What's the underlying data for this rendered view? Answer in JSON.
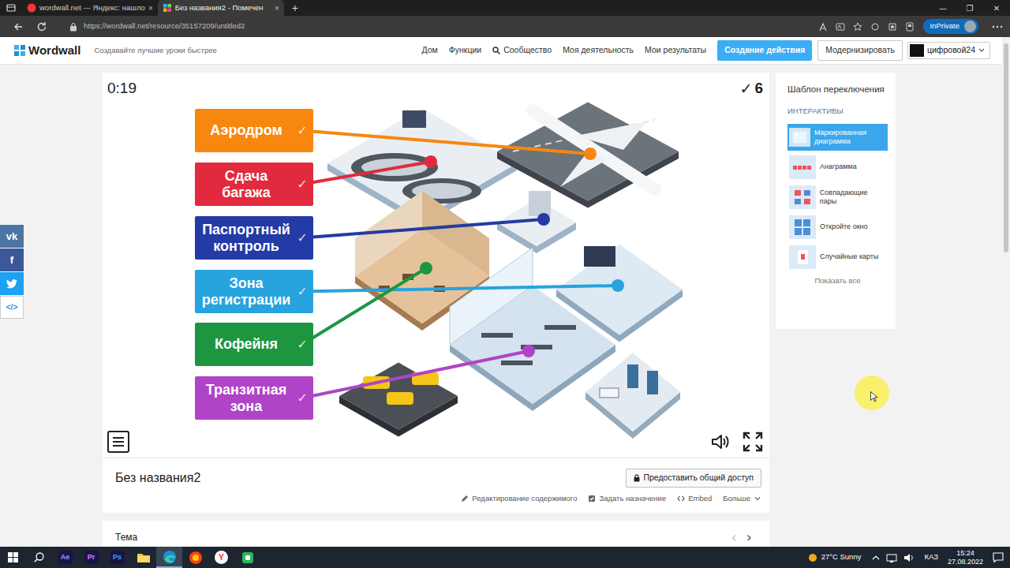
{
  "browser": {
    "tabs": [
      {
        "label": "wordwall.net — Яндекс: нашло",
        "selected": false
      },
      {
        "label": "Без названия2 - Помечен",
        "selected": true
      }
    ],
    "close": "×",
    "new_tab": "+",
    "controls": [
      "—",
      "❐",
      "✕"
    ],
    "url": "https://wordwall.net/resource/35157209/untitled2",
    "inprivate": "InPrivate"
  },
  "site": {
    "logo": "Wordwall",
    "tagline": "Создавайте лучшие уроки быстрее",
    "nav": [
      "Дом",
      "Функции",
      "Сообщество",
      "Моя деятельность",
      "Мои результаты"
    ],
    "create": "Создание действия",
    "upgrade": "Модернизировать",
    "user": "цифровой24"
  },
  "social": [
    {
      "kind": "vk",
      "label": "vk",
      "color": "#4c75a3"
    },
    {
      "kind": "facebook",
      "label": "f",
      "color": "#3b5998"
    },
    {
      "kind": "twitter",
      "color": "#1da1f2"
    },
    {
      "kind": "embed",
      "label": "</>",
      "color": "#ffffff"
    }
  ],
  "game": {
    "timer": "0:19",
    "score_icon": "✓",
    "score": "6",
    "labels": [
      {
        "text": "Аэродром",
        "color": "#f7870f",
        "correct": true,
        "check": "✓"
      },
      {
        "text": "Сдача багажа",
        "color": "#e22a3e",
        "correct": true,
        "check": "✓"
      },
      {
        "text": "Паспортный контроль",
        "color": "#243aa6",
        "correct": true,
        "check": "✓"
      },
      {
        "text": "Зона регистрации",
        "color": "#27a3dd",
        "correct": true,
        "check": "✓"
      },
      {
        "text": "Кофейня",
        "color": "#1e9641",
        "correct": true,
        "check": "✓"
      },
      {
        "text": "Транзитная зона",
        "color": "#b044c6",
        "correct": true,
        "check": "✓"
      }
    ]
  },
  "activity": {
    "title": "Без названия2",
    "share": "Предоставить общий доступ",
    "actions": [
      {
        "kind": "edit",
        "label": "Редактирование содержимого"
      },
      {
        "kind": "assign",
        "label": "Задать назначение"
      },
      {
        "kind": "embed",
        "label": "Embed"
      },
      {
        "kind": "more",
        "label": "Больше"
      }
    ]
  },
  "theme": {
    "title": "Тема",
    "arrows": [
      {
        "label": "‹",
        "disabled": true
      },
      {
        "label": "›",
        "disabled": false
      }
    ]
  },
  "templates": {
    "title": "Шаблон переключения",
    "section": "ИНТЕРАКТИВЫ",
    "items": [
      {
        "label": "Маркированная диаграмма",
        "selected": true
      },
      {
        "label": "Анаграмма",
        "selected": false
      },
      {
        "label": "Совпадающие пары",
        "selected": false
      },
      {
        "label": "Откройте окно",
        "selected": false
      },
      {
        "label": "Случайные карты",
        "selected": false
      }
    ],
    "show_all": "Показать все"
  },
  "taskbar": {
    "apps": [
      {
        "kind": "adobe",
        "label": "Ae",
        "color": "#9999ff",
        "selected": false
      },
      {
        "kind": "adobe",
        "label": "Pr",
        "color": "#ea77ff",
        "selected": false
      },
      {
        "kind": "adobe",
        "label": "Ps",
        "color": "#31a8ff",
        "selected": false
      },
      {
        "kind": "folder",
        "selected": false
      },
      {
        "kind": "edge",
        "selected": true
      },
      {
        "kind": "yandex-browser",
        "selected": false
      },
      {
        "kind": "yandex",
        "label": "Y",
        "selected": false
      },
      {
        "kind": "app",
        "selected": false
      }
    ],
    "weather": "27°C Sunny",
    "lang": "КАЗ",
    "time": "15:24",
    "date": "27.08.2022"
  }
}
